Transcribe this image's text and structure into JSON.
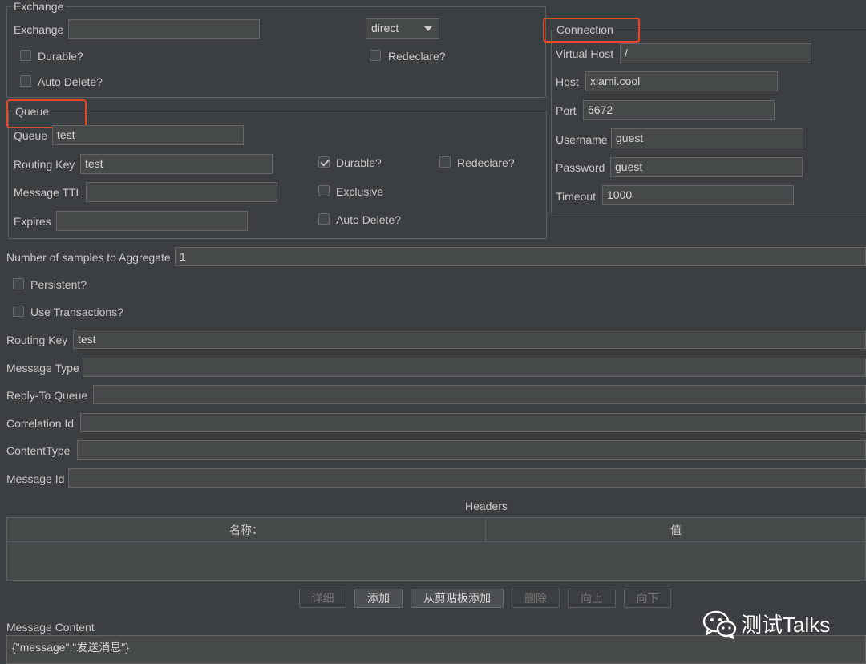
{
  "exchange": {
    "legend": "Exchange",
    "exchange_label": "Exchange",
    "exchange_value": "",
    "type_value": "direct",
    "durable_label": "Durable?",
    "redeclare_label": "Redeclare?",
    "auto_delete_label": "Auto Delete?"
  },
  "queue": {
    "legend": "Queue",
    "queue_label": "Queue",
    "queue_value": "test",
    "routing_key_label": "Routing Key",
    "routing_key_value": "test",
    "message_ttl_label": "Message TTL",
    "message_ttl_value": "",
    "expires_label": "Expires",
    "expires_value": "",
    "durable_label": "Durable?",
    "durable_checked": true,
    "redeclare_label": "Redeclare?",
    "exclusive_label": "Exclusive",
    "auto_delete_label": "Auto Delete?"
  },
  "connection": {
    "legend": "Connection",
    "virtual_host_label": "Virtual Host",
    "virtual_host_value": "/",
    "host_label": "Host",
    "host_value": "xiami.cool",
    "port_label": "Port",
    "port_value": "5672",
    "username_label": "Username",
    "username_value": "guest",
    "password_label": "Password",
    "password_value": "guest",
    "timeout_label": "Timeout",
    "timeout_value": "1000"
  },
  "publish": {
    "samples_label": "Number of samples to Aggregate",
    "samples_value": "1",
    "persistent_label": "Persistent?",
    "transactions_label": "Use Transactions?",
    "routing_key_label": "Routing Key",
    "routing_key_value": "test",
    "message_type_label": "Message Type",
    "reply_to_label": "Reply-To Queue",
    "correlation_label": "Correlation Id",
    "content_type_label": "ContentType",
    "message_id_label": "Message Id"
  },
  "headers": {
    "title": "Headers",
    "col_name": "名称：",
    "col_value": "值",
    "buttons": {
      "detail": "详细",
      "add": "添加",
      "add_from_clipboard": "从剪贴板添加",
      "delete": "删除",
      "up": "向上",
      "down": "向下"
    }
  },
  "message": {
    "label": "Message Content",
    "content": "{\"message\":\"发送消息\"}"
  },
  "watermark": {
    "text": "测试Talks"
  },
  "colors": {
    "background": "#3c3f41",
    "field": "#45494a",
    "highlight": "#e8472b"
  }
}
